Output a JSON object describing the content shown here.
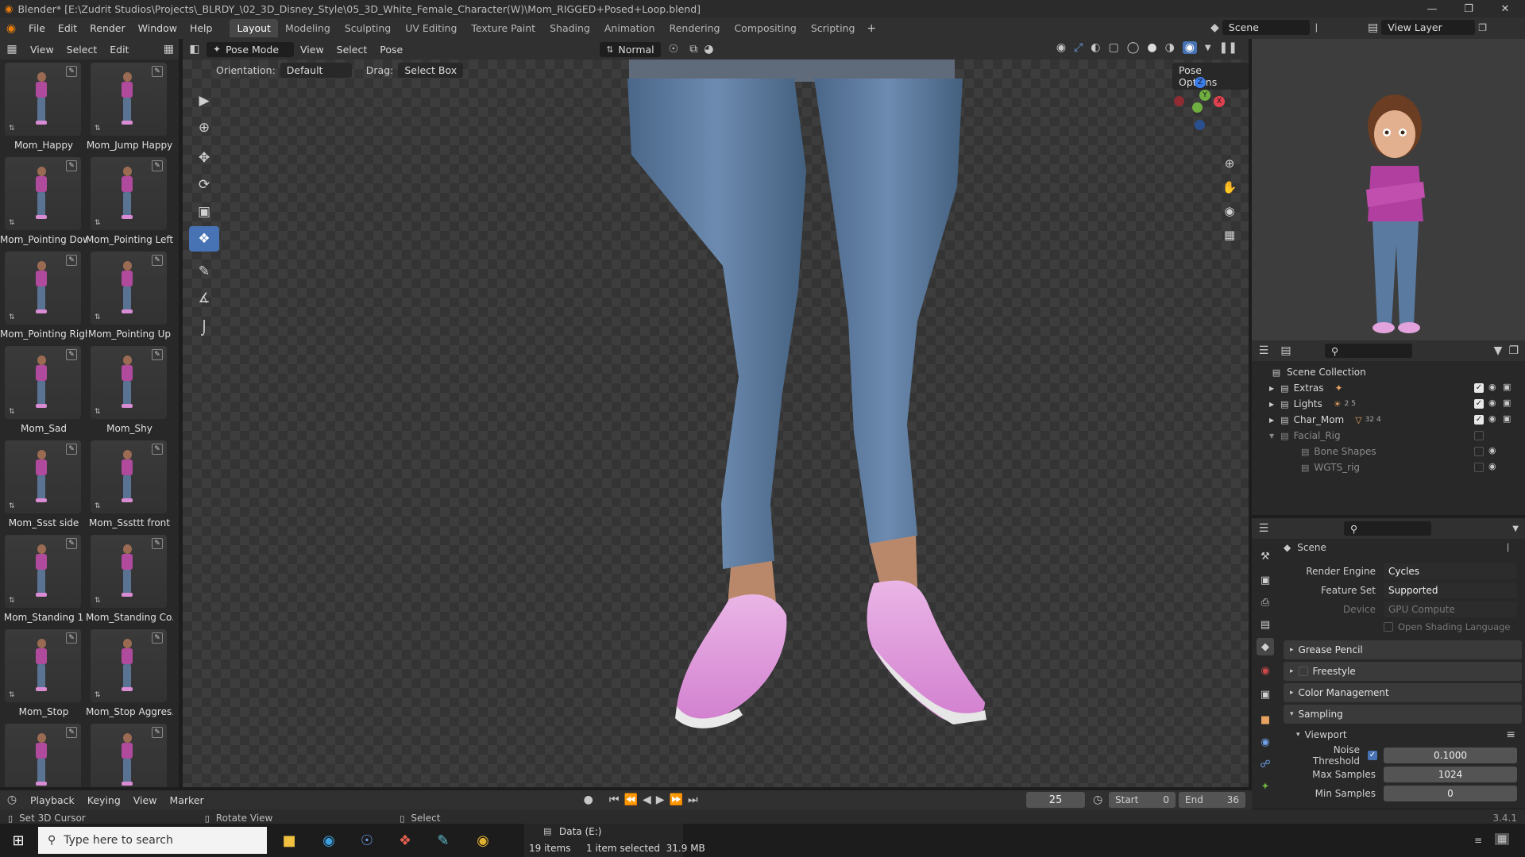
{
  "window": {
    "title": "Blender* [E:\\Zudrit Studios\\Projects\\_BLRDY_\\02_3D_Disney_Style\\05_3D_White_Female_Character(W)\\Mom_RIGGED+Posed+Loop.blend]"
  },
  "menu": [
    "File",
    "Edit",
    "Render",
    "Window",
    "Help"
  ],
  "workspaces": [
    "Layout",
    "Modeling",
    "Sculpting",
    "UV Editing",
    "Texture Paint",
    "Shading",
    "Animation",
    "Rendering",
    "Compositing",
    "Scripting"
  ],
  "active_workspace": "Layout",
  "scene_field": "Scene",
  "view_layer_field": "View Layer",
  "asset_header": {
    "view": "View",
    "select": "Select",
    "edit": "Edit"
  },
  "assets": [
    "Mom_Happy",
    "Mom_Jump Happy",
    "Mom_Pointing Down",
    "Mom_Pointing Left",
    "Mom_Pointing Right",
    "Mom_Pointing Up",
    "Mom_Sad",
    "Mom_Shy",
    "Mom_Ssst side",
    "Mom_Sssttt front",
    "Mom_Standing 1",
    "Mom_Standing Co...",
    "Mom_Stop",
    "Mom_Stop Aggres..."
  ],
  "viewport_header": {
    "mode": "Pose Mode",
    "view": "View",
    "select": "Select",
    "pose": "Pose",
    "orientation_label": "Orientation:",
    "orientation_value": "Default",
    "drag_label": "Drag:",
    "drag_value": "Select Box",
    "transform_orientation": "Normal",
    "pose_options": "Pose Options"
  },
  "gizmo": {
    "z": "Z",
    "y": "Y",
    "x": "X"
  },
  "outliner": {
    "root": "Scene Collection",
    "items": [
      {
        "name": "Extras"
      },
      {
        "name": "Lights",
        "badges": "2 5"
      },
      {
        "name": "Char_Mom",
        "badges": "32 4"
      },
      {
        "name": "Facial_Rig"
      },
      {
        "name": "Bone Shapes"
      },
      {
        "name": "WGTS_rig"
      }
    ]
  },
  "properties": {
    "context": "Scene",
    "render_engine_label": "Render Engine",
    "render_engine": "Cycles",
    "feature_set_label": "Feature Set",
    "feature_set": "Supported",
    "device_label": "Device",
    "device": "GPU Compute",
    "osl": "Open Shading Language",
    "panels": [
      "Grease Pencil",
      "Freestyle",
      "Color Management",
      "Sampling"
    ],
    "viewport_sub": "Viewport",
    "noise_threshold_label": "Noise Threshold",
    "noise_threshold": "0.1000",
    "max_samples_label": "Max Samples",
    "max_samples": "1024",
    "min_samples_label": "Min Samples",
    "min_samples": "0"
  },
  "timeline": {
    "playback": "Playback",
    "keying": "Keying",
    "view": "View",
    "marker": "Marker",
    "current_frame": "25",
    "start_label": "Start",
    "start": "0",
    "end_label": "End",
    "end": "36"
  },
  "status": {
    "left": "Set 3D Cursor",
    "mid": "Rotate View",
    "right": "Select",
    "version": "3.4.1"
  },
  "taskbar": {
    "search": "Type here to search",
    "drive": "Data (E:)",
    "items_count": "19 items",
    "selected": "1 item selected  31.9 MB"
  }
}
